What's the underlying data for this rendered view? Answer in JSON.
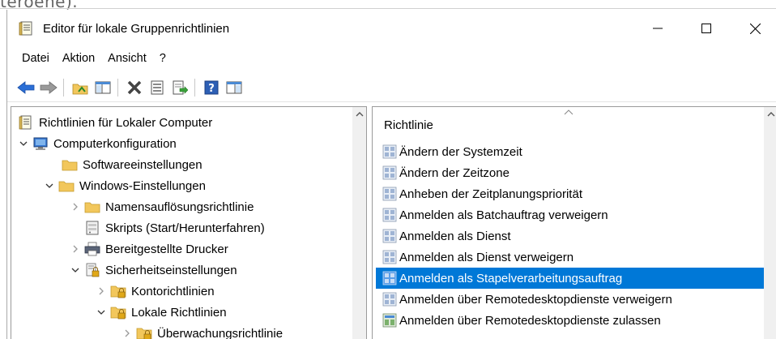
{
  "page_text_top": "teroene).",
  "window": {
    "title": "Editor für lokale Gruppenrichtlinien"
  },
  "window_controls": {
    "minimize": "—",
    "maximize": "☐",
    "close": "✕"
  },
  "menu": [
    "Datei",
    "Aktion",
    "Ansicht",
    "?"
  ],
  "toolbar": {
    "icons": [
      "back-icon",
      "forward-icon",
      "up-folder-icon",
      "show-hide-tree-icon",
      "delete-icon",
      "properties-icon",
      "export-list-icon",
      "help-icon",
      "show-hide-action-pane-icon"
    ]
  },
  "tree": {
    "items": [
      {
        "label": "Richtlinien für Lokaler Computer",
        "icon": "policy-document-icon",
        "expander": "",
        "level": 0
      },
      {
        "label": "Computerkonfiguration",
        "icon": "computer-icon",
        "expander": "expanded",
        "level": 0
      },
      {
        "label": "Softwareeinstellungen",
        "icon": "folder-icon",
        "expander": "",
        "level": 1
      },
      {
        "label": "Windows-Einstellungen",
        "icon": "folder-icon",
        "expander": "expanded",
        "level": 1
      },
      {
        "label": "Namensauflösungsrichtlinie",
        "icon": "folder-icon",
        "expander": "collapsed",
        "level": 2
      },
      {
        "label": "Skripts (Start/Herunterfahren)",
        "icon": "script-icon",
        "expander": "",
        "level": 2
      },
      {
        "label": "Bereitgestellte Drucker",
        "icon": "printer-icon",
        "expander": "collapsed",
        "level": 2
      },
      {
        "label": "Sicherheitseinstellungen",
        "icon": "security-settings-icon",
        "expander": "expanded",
        "level": 2
      },
      {
        "label": "Kontorichtlinien",
        "icon": "secure-folder-icon",
        "expander": "collapsed",
        "level": 3
      },
      {
        "label": "Lokale Richtlinien",
        "icon": "secure-folder-icon",
        "expander": "expanded",
        "level": 3
      },
      {
        "label": "Überwachungsrichtlinie",
        "icon": "secure-folder-icon",
        "expander": "collapsed",
        "level": 4
      }
    ]
  },
  "list": {
    "column_header": "Richtlinie",
    "items": [
      {
        "label": "Ändern der Systemzeit",
        "icon": "policy-setting-icon",
        "selected": false
      },
      {
        "label": "Ändern der Zeitzone",
        "icon": "policy-setting-icon",
        "selected": false
      },
      {
        "label": "Anheben der Zeitplanungspriorität",
        "icon": "policy-setting-icon",
        "selected": false
      },
      {
        "label": "Anmelden als Batchauftrag verweigern",
        "icon": "policy-setting-icon",
        "selected": false
      },
      {
        "label": "Anmelden als Dienst",
        "icon": "policy-setting-icon",
        "selected": false
      },
      {
        "label": "Anmelden als Dienst verweigern",
        "icon": "policy-setting-icon",
        "selected": false
      },
      {
        "label": "Anmelden als Stapelverarbeitungsauftrag",
        "icon": "policy-setting-icon",
        "selected": true
      },
      {
        "label": "Anmelden über Remotedesktopdienste verweigern",
        "icon": "policy-setting-icon",
        "selected": false
      },
      {
        "label": "Anmelden über Remotedesktopdienste zulassen",
        "icon": "policy-setting-alt-icon",
        "selected": false
      }
    ]
  },
  "colors": {
    "selection": "#0078d7",
    "folder": "#f2c75c",
    "back_arrow": "#2b6fd6"
  }
}
